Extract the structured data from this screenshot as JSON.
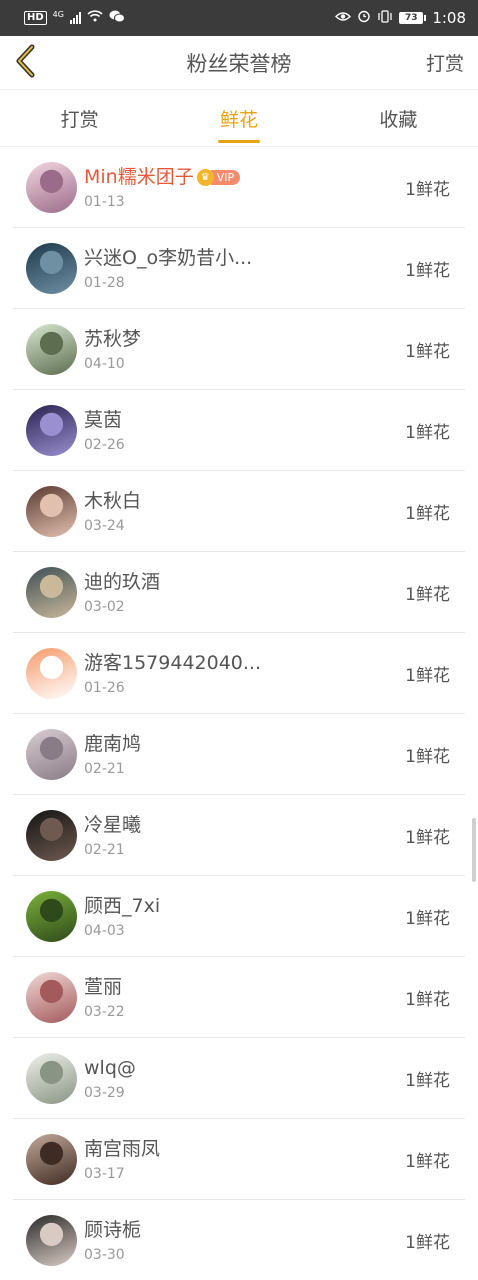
{
  "status_bar": {
    "hd": "HD",
    "net": "4G",
    "battery": "73",
    "time": "1:08"
  },
  "nav": {
    "title": "粉丝荣誉榜",
    "right_action": "打赏"
  },
  "tabs": [
    {
      "label": "打赏",
      "active": false
    },
    {
      "label": "鲜花",
      "active": true
    },
    {
      "label": "收藏",
      "active": false
    }
  ],
  "list": [
    {
      "name": "Min糯米团子",
      "date": "01-13",
      "gift": "1鲜花",
      "vip": true,
      "vip_label": "VIP",
      "avatar_colors": [
        "#f3d6e0",
        "#9b6b8a"
      ]
    },
    {
      "name": "兴迷O_o李奶昔小...",
      "date": "01-28",
      "gift": "1鲜花",
      "vip": false,
      "avatar_colors": [
        "#1f3a4d",
        "#6f8fa3"
      ]
    },
    {
      "name": "苏秋梦",
      "date": "04-10",
      "gift": "1鲜花",
      "vip": false,
      "avatar_colors": [
        "#d8e6d0",
        "#5c6e4f"
      ]
    },
    {
      "name": "莫茵",
      "date": "02-26",
      "gift": "1鲜花",
      "vip": false,
      "avatar_colors": [
        "#2b2350",
        "#9a8fd0"
      ]
    },
    {
      "name": "木秋白",
      "date": "03-24",
      "gift": "1鲜花",
      "vip": false,
      "avatar_colors": [
        "#5a3a30",
        "#e2c0b0"
      ]
    },
    {
      "name": "迪的玖酒",
      "date": "03-02",
      "gift": "1鲜花",
      "vip": false,
      "avatar_colors": [
        "#3f4f55",
        "#c9b89a"
      ]
    },
    {
      "name": "游客1579442040...",
      "date": "01-26",
      "gift": "1鲜花",
      "vip": false,
      "avatar_colors": [
        "#f59a6a",
        "#ffffff"
      ]
    },
    {
      "name": "鹿南鸠",
      "date": "02-21",
      "gift": "1鲜花",
      "vip": false,
      "avatar_colors": [
        "#d8ccd2",
        "#8a7c86"
      ]
    },
    {
      "name": "冷星曦",
      "date": "02-21",
      "gift": "1鲜花",
      "vip": false,
      "avatar_colors": [
        "#141414",
        "#6e5a50"
      ]
    },
    {
      "name": "顾西_7xi",
      "date": "04-03",
      "gift": "1鲜花",
      "vip": false,
      "avatar_colors": [
        "#7bb13a",
        "#2f4a1a"
      ]
    },
    {
      "name": "萱丽",
      "date": "03-22",
      "gift": "1鲜花",
      "vip": false,
      "avatar_colors": [
        "#f2d8d8",
        "#a35a5a"
      ]
    },
    {
      "name": "wlq@",
      "date": "03-29",
      "gift": "1鲜花",
      "vip": false,
      "avatar_colors": [
        "#eef0ea",
        "#8a9484"
      ]
    },
    {
      "name": "南宫雨凤",
      "date": "03-17",
      "gift": "1鲜花",
      "vip": false,
      "avatar_colors": [
        "#c5a99a",
        "#3e2b24"
      ]
    },
    {
      "name": "顾诗栀",
      "date": "03-30",
      "gift": "1鲜花",
      "vip": false,
      "avatar_colors": [
        "#2a2a2a",
        "#d9cbc4"
      ]
    }
  ],
  "colors": {
    "accent": "#e8a317",
    "vip_name": "#e35b3f",
    "status_bar_bg": "#3b3b3b"
  }
}
